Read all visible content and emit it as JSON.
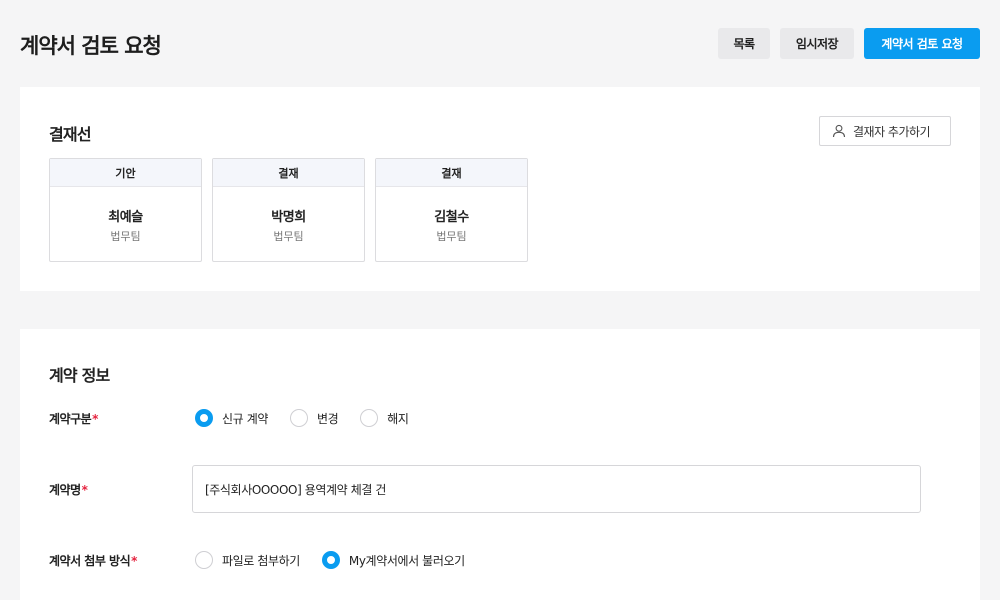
{
  "header": {
    "title": "계약서 검토 요청",
    "buttons": {
      "list": "목록",
      "draft": "임시저장",
      "submit": "계약서 검토 요청"
    }
  },
  "approval": {
    "title": "결재선",
    "add_button": "결재자 추가하기",
    "approvers": [
      {
        "stage": "기안",
        "name": "최예슬",
        "dept": "법무팀"
      },
      {
        "stage": "결재",
        "name": "박명희",
        "dept": "법무팀"
      },
      {
        "stage": "결재",
        "name": "김철수",
        "dept": "법무팀"
      }
    ]
  },
  "contract": {
    "title": "계약 정보",
    "type": {
      "label": "계약구분",
      "required": "*",
      "options": [
        "신규 계약",
        "변경",
        "해지"
      ],
      "selected": "신규 계약"
    },
    "name": {
      "label": "계약명",
      "required": "*",
      "value": "[주식회사OOOOO] 용역계약 체결 건"
    },
    "attach": {
      "label": "계약서 첨부 방식",
      "required": "*",
      "options": [
        "파일로 첨부하기",
        "My계약서에서 불러오기"
      ],
      "selected": "My계약서에서 불러오기"
    }
  },
  "colors": {
    "primary": "#0a9cf0",
    "required": "#e5233f",
    "background": "#f5f5f6"
  },
  "icons": {
    "add_approver": "user-icon"
  }
}
